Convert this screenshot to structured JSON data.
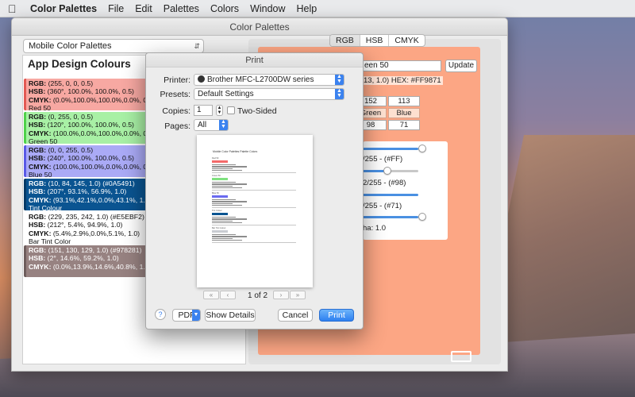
{
  "menubar": {
    "app_name": "Color Palettes",
    "items": [
      "File",
      "Edit",
      "Palettes",
      "Colors",
      "Window",
      "Help"
    ]
  },
  "window": {
    "title": "Color Palettes"
  },
  "left": {
    "palette_select": "Mobile Color Palettes",
    "heading": "App Design Colours",
    "swatches": [
      {
        "rgb": "(255, 0, 0, 0.5)",
        "hsb": "(360°, 100.0%, 100.0%, 0.5)",
        "cmyk": "(0.0%,100.0%,100.0%,0.0%, 0.5)",
        "name": "Red 50",
        "bg": "#f7a8a2",
        "border": "#e35a54"
      },
      {
        "rgb": "(0, 255, 0, 0.5)",
        "hsb": "(120°, 100.0%, 100.0%, 0.5)",
        "cmyk": "(100.0%,0.0%,100.0%,0.0%, 0.5)",
        "name": "Green 50",
        "bg": "#a8f0a5",
        "border": "#4fd14a"
      },
      {
        "rgb": "(0, 0, 255, 0.5)",
        "hsb": "(240°, 100.0%, 100.0%, 0.5)",
        "cmyk": "(100.0%,100.0%,0.0%,0.0%, 0.5)",
        "name": "Blue 50",
        "bg": "#aaaaf6",
        "border": "#5a5ae6"
      },
      {
        "rgb": "(10, 84, 145, 1.0) (#0A5491)",
        "hsb": "(207°, 93.1%, 56.9%, 1.0)",
        "cmyk": "(93.1%,42.1%,0.0%,43.1%, 1.0)",
        "name": "Tint Colour",
        "bg": "#0a5491",
        "border": "#063a66"
      },
      {
        "rgb": "(229, 235, 242, 1.0) (#E5EBF2)",
        "hsb": "(212°, 5.4%, 94.9%, 1.0)",
        "cmyk": "(5.4%,2.9%,0.0%,5.1%, 1.0)",
        "name": "Bar Tint Color",
        "bg": "#ffffff",
        "border": "#ffffff"
      },
      {
        "rgb": "(151, 130, 129, 1.0) (#978281)",
        "hsb": "(2°, 14.6%, 59.2%, 1.0)",
        "cmyk": "(0.0%,13.9%,14.6%,40.8%, 1.0)",
        "name": "",
        "bg": "#978281",
        "border": "#6e5d5c"
      }
    ],
    "labels": {
      "rgb": "RGB:",
      "hsb": "HSB:",
      "cmyk": "CMYK:"
    }
  },
  "right": {
    "tabs": [
      "RGB",
      "HSB",
      "CMYK"
    ],
    "active_tab": "RGB",
    "name_value": "een 50",
    "update_label": "Update",
    "info_line": "13, 1.0) HEX: #FF9871",
    "values": [
      "152",
      "113"
    ],
    "channel_labels": [
      "Green",
      "Blue"
    ],
    "channel_values": [
      "98",
      "71"
    ],
    "slider_rows": [
      "/255 - (#FF)",
      "2/255 - (#98)",
      "/255 - (#71)",
      "ha: 1.0"
    ],
    "slider_levels": [
      1.0,
      0.6,
      1.0
    ],
    "panel_color": "#fca684"
  },
  "print": {
    "title": "Print",
    "printer_label": "Printer:",
    "printer_value": "Brother MFC-L2700DW series",
    "presets_label": "Presets:",
    "presets_value": "Default Settings",
    "copies_label": "Copies:",
    "copies_value": "1",
    "two_sided_label": "Two-Sided",
    "pages_label": "Pages:",
    "pages_value": "All",
    "preview_title": "Mobile Color Palettes Palette Colors",
    "preview_entries": [
      {
        "name": "Red 50",
        "color": "#f36a6a"
      },
      {
        "name": "Green 50",
        "color": "#7ee07e"
      },
      {
        "name": "Blue 50",
        "color": "#6b6bf0"
      },
      {
        "name": "Tint Colour",
        "color": "#0a5491"
      },
      {
        "name": "Bar Tint Colour",
        "color": "#c9ccd2"
      }
    ],
    "page_indicator": "1 of 2",
    "pager_buttons": [
      "«",
      "‹",
      "›",
      "»"
    ],
    "help_label": "?",
    "pdf_label": "PDF",
    "show_details_label": "Show Details",
    "cancel_label": "Cancel",
    "print_label": "Print"
  },
  "icons": {
    "apple": "apple-icon",
    "printer": "printer-icon",
    "chevron": "chevron-updown-icon"
  }
}
